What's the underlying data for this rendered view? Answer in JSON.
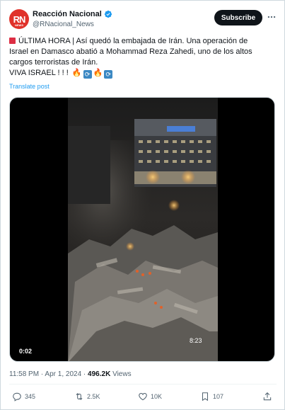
{
  "post": {
    "author": {
      "display_name": "Reacción Nacional",
      "handle": "@RNacional_News",
      "avatar_text": "RN",
      "avatar_subtext": "NEWS",
      "brand_color": "#e0322a",
      "verified_color": "#1d9bf0"
    },
    "subscribe_label": "Subscribe",
    "more_icon": "more-horizontal-icon",
    "text_lines": [
      "ÚLTIMA HORA | Así quedó la embajada de Irán. Una operación de",
      "Israel en Damasco abatió a Mohammad Reza Zahedi, uno de los altos",
      "cargos terroristas de Irán.",
      "VIVA ISRAEL ! ! !"
    ],
    "translate_label": "Translate post",
    "video": {
      "timestamp": "0:02",
      "overlay_timestamp": "8:23"
    },
    "meta": {
      "time": "11:58 PM",
      "separator": "·",
      "date": "Apr 1, 2024",
      "views_count": "496.2K",
      "views_label": "Views"
    },
    "actions": {
      "replies": "345",
      "reposts": "2.5K",
      "likes": "10K",
      "bookmarks": "107"
    }
  }
}
